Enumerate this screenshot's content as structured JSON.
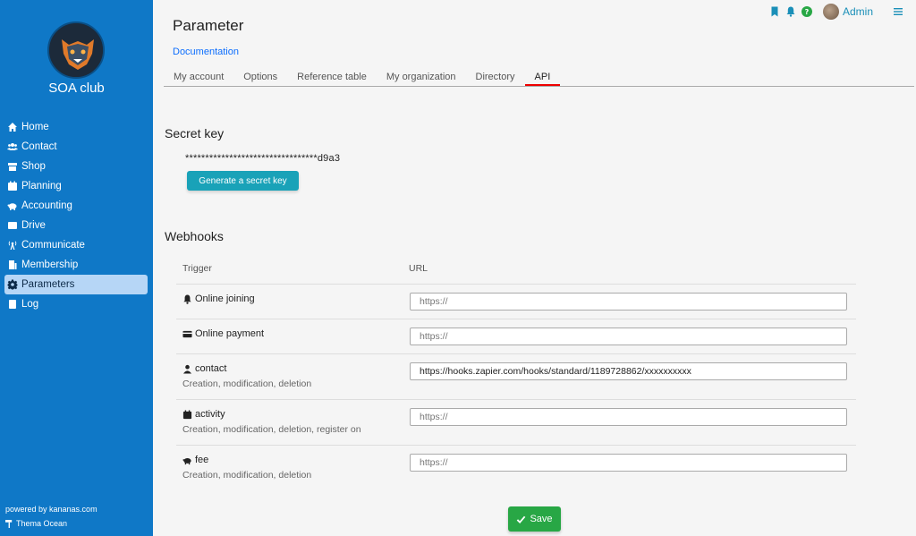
{
  "sidebar": {
    "brand": "SOA club",
    "items": [
      {
        "label": "Home",
        "icon": "home-icon"
      },
      {
        "label": "Contact",
        "icon": "users-icon"
      },
      {
        "label": "Shop",
        "icon": "store-icon"
      },
      {
        "label": "Planning",
        "icon": "calendar-icon"
      },
      {
        "label": "Accounting",
        "icon": "piggy-bank-icon"
      },
      {
        "label": "Drive",
        "icon": "hdd-icon"
      },
      {
        "label": "Communicate",
        "icon": "broadcast-icon"
      },
      {
        "label": "Membership",
        "icon": "id-card-icon"
      },
      {
        "label": "Parameters",
        "icon": "gear-icon",
        "active": true
      },
      {
        "label": "Log",
        "icon": "book-icon"
      }
    ],
    "powered_by": "powered by kananas.com",
    "theme": "Thema Ocean"
  },
  "topbar": {
    "user": "Admin"
  },
  "page": {
    "title": "Parameter",
    "doc_link": "Documentation"
  },
  "tabs": [
    {
      "label": "My account"
    },
    {
      "label": "Options"
    },
    {
      "label": "Reference table"
    },
    {
      "label": "My organization"
    },
    {
      "label": "Directory"
    },
    {
      "label": "API",
      "active": true
    }
  ],
  "secret": {
    "heading": "Secret key",
    "value": "*********************************d9a3",
    "generate_label": "Generate a secret key"
  },
  "webhooks": {
    "heading": "Webhooks",
    "col_trigger": "Trigger",
    "col_url": "URL",
    "rows": [
      {
        "trigger": "Online joining",
        "icon": "bell-icon",
        "sub": "",
        "value": "",
        "placeholder": "https://"
      },
      {
        "trigger": "Online payment",
        "icon": "credit-card-icon",
        "sub": "",
        "value": "",
        "placeholder": "https://"
      },
      {
        "trigger": "contact",
        "icon": "user-icon",
        "sub": "Creation, modification, deletion",
        "value": "https://hooks.zapier.com/hooks/standard/1189728862/xxxxxxxxxx",
        "placeholder": "https://"
      },
      {
        "trigger": "activity",
        "icon": "calendar-icon",
        "sub": "Creation, modification, deletion, register on",
        "value": "",
        "placeholder": "https://"
      },
      {
        "trigger": "fee",
        "icon": "piggy-bank-icon",
        "sub": "Creation, modification, deletion",
        "value": "",
        "placeholder": "https://"
      }
    ]
  },
  "save_label": "Save",
  "colors": {
    "sidebar": "#0f78c7",
    "active_item": "#b6d6f6",
    "primary_button": "#19a2b8",
    "save_button": "#28a745",
    "tab_underline": "#e00000"
  }
}
